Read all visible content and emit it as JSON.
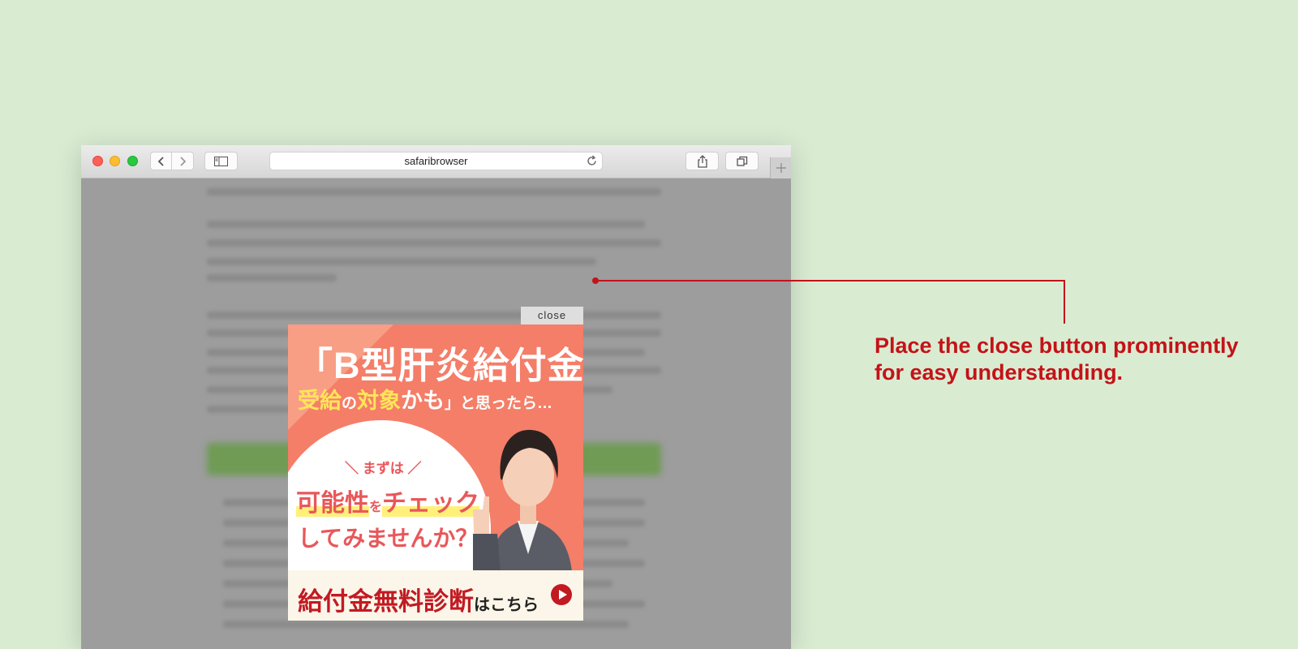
{
  "browser": {
    "url": "safaribrowser",
    "icons": [
      "chevron-left-icon",
      "chevron-right-icon",
      "sidebar-icon",
      "reload-icon",
      "share-icon",
      "tabs-icon",
      "plus-icon"
    ]
  },
  "ad": {
    "close_label": "close",
    "headline": "「B型肝炎給付金",
    "sub_yellow1": "受給",
    "sub_white1": "の",
    "sub_yellow2": "対象",
    "sub_white2": "かも",
    "sub_rest": "」と思ったら…",
    "small_prompt": "＼ まずは ／",
    "check_part1": "可能性",
    "check_joiner": "を",
    "check_part2": "チェック",
    "ask": "してみませんか？",
    "cta_main": "給付金無料診断",
    "cta_suffix": "はこちら"
  },
  "annotation": {
    "text_line1": "Place the close button prominently",
    "text_line2": "for easy understanding.",
    "color": "#c51218"
  }
}
